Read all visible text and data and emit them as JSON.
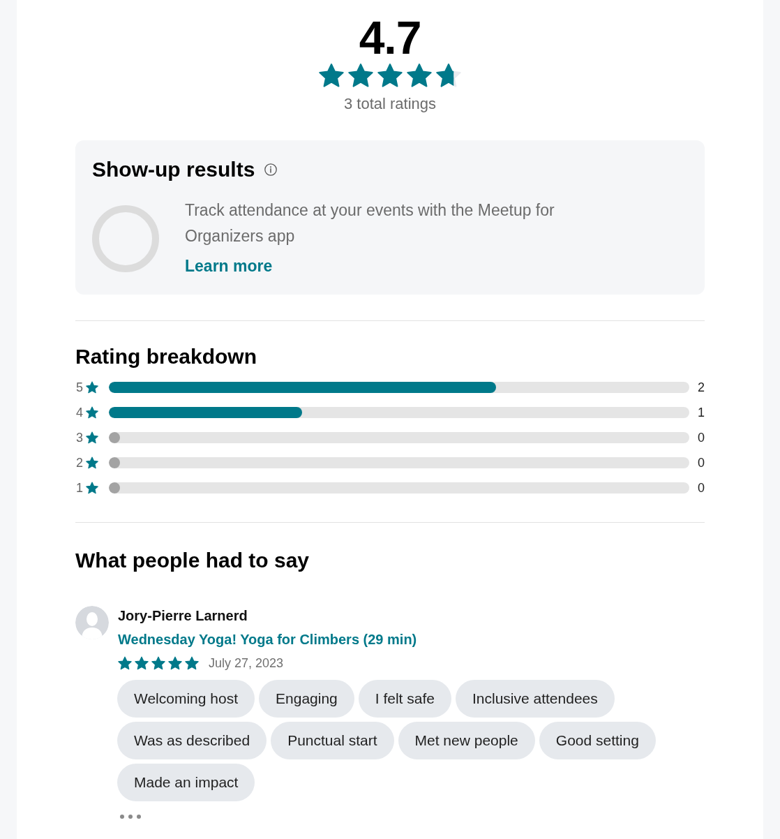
{
  "summary": {
    "rating": "4.7",
    "stars": 4.7,
    "total": "3 total ratings"
  },
  "show_up": {
    "title": "Show-up results",
    "text": "Track attendance at your events with the Meetup for Organizers app",
    "link": "Learn more"
  },
  "rating_breakdown": {
    "title": "Rating breakdown",
    "rows": [
      {
        "label": "5",
        "level": 0.667,
        "count": "2"
      },
      {
        "label": "4",
        "level": 0.333,
        "count": "1"
      },
      {
        "label": "3",
        "level": 0,
        "count": "0"
      },
      {
        "label": "2",
        "level": 0,
        "count": "0"
      },
      {
        "label": "1",
        "level": 0,
        "count": "0"
      }
    ]
  },
  "reviews": {
    "title": "What people had to say",
    "items": [
      {
        "name": "Jory-Pierre Larnerd",
        "event": "Wednesday Yoga! Yoga for Climbers (29 min)",
        "stars": 5,
        "date": "July 27, 2023",
        "tags": [
          "Welcoming host",
          "Engaging",
          "I felt safe",
          "Inclusive attendees",
          "Was as described",
          "Punctual start",
          "Met new people",
          "Good setting",
          "Made an impact"
        ]
      }
    ]
  }
}
